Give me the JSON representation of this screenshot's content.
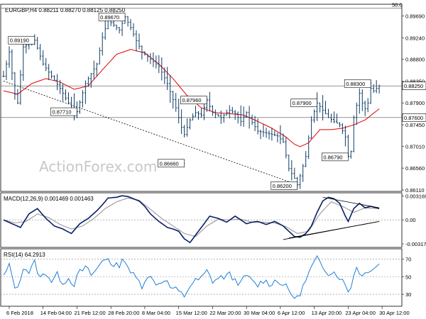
{
  "chart_data": {
    "type": "line",
    "title": "EURGBP,H4  0.88211 0.88270 0.88125 0.88250",
    "watermark": "ActionForex.com",
    "price_axis": {
      "ticks": [
        "0.89690",
        "0.89240",
        "0.88800",
        "0.88350",
        "0.87900",
        "0.87450",
        "0.87010",
        "0.86560",
        "0.86110"
      ],
      "tick_values": [
        0.8969,
        0.8924,
        0.888,
        0.8835,
        0.879,
        0.8745,
        0.8701,
        0.8656,
        0.8611
      ],
      "ylim": [
        0.8611,
        0.899
      ],
      "fib_label": "50.0",
      "fib_level": 0.8985,
      "current_price_label": "0.88250",
      "current_price": 0.8825,
      "support_label": "0.87600",
      "support_level": 0.876
    },
    "x_axis": {
      "labels": [
        "6 Feb 2018",
        "14 Feb 04:00",
        "21 Feb 12:00",
        "28 Feb 20:00",
        "8 Mar 04:00",
        "15 Mar 12:00",
        "22 Mar 20:00",
        "30 Mar 04:00",
        "6 Apr 12:00",
        "13 Apr 20:00",
        "23 Apr 04:00",
        "30 Apr 12:00"
      ],
      "label_bars": [
        2,
        14,
        26,
        38,
        50,
        62,
        74,
        86,
        98,
        110,
        122,
        134
      ]
    },
    "price_series": {
      "name": "EURGBP",
      "anchors": [
        [
          0,
          0.8845
        ],
        [
          2,
          0.8895
        ],
        [
          4,
          0.8808
        ],
        [
          5,
          0.879
        ],
        [
          7,
          0.8905
        ],
        [
          11,
          0.8919
        ],
        [
          14,
          0.887
        ],
        [
          17,
          0.8845
        ],
        [
          20,
          0.882
        ],
        [
          23,
          0.879
        ],
        [
          26,
          0.8772
        ],
        [
          29,
          0.883
        ],
        [
          33,
          0.887
        ],
        [
          35,
          0.8925
        ],
        [
          37,
          0.896
        ],
        [
          39,
          0.895
        ],
        [
          41,
          0.894
        ],
        [
          43,
          0.8967
        ],
        [
          45,
          0.8945
        ],
        [
          47,
          0.8918
        ],
        [
          49,
          0.8895
        ],
        [
          52,
          0.888
        ],
        [
          55,
          0.8865
        ],
        [
          58,
          0.883
        ],
        [
          61,
          0.878
        ],
        [
          63,
          0.874
        ],
        [
          64,
          0.8725
        ],
        [
          66,
          0.8755
        ],
        [
          68,
          0.877
        ],
        [
          70,
          0.8765
        ],
        [
          72,
          0.8796
        ],
        [
          74,
          0.877
        ],
        [
          77,
          0.876
        ],
        [
          80,
          0.8775
        ],
        [
          82,
          0.8768
        ],
        [
          84,
          0.8752
        ],
        [
          86,
          0.877
        ],
        [
          88,
          0.875
        ],
        [
          90,
          0.8732
        ],
        [
          93,
          0.8728
        ],
        [
          95,
          0.8725
        ],
        [
          97,
          0.8722
        ],
        [
          99,
          0.871
        ],
        [
          101,
          0.8655
        ],
        [
          103,
          0.8635
        ],
        [
          104,
          0.8622
        ],
        [
          105,
          0.864
        ],
        [
          107,
          0.868
        ],
        [
          109,
          0.8755
        ],
        [
          111,
          0.879
        ],
        [
          113,
          0.8775
        ],
        [
          115,
          0.876
        ],
        [
          117,
          0.8752
        ],
        [
          119,
          0.8745
        ],
        [
          121,
          0.872
        ],
        [
          122,
          0.868
        ],
        [
          123,
          0.869
        ],
        [
          124,
          0.876
        ],
        [
          126,
          0.881
        ],
        [
          127,
          0.879
        ],
        [
          128,
          0.8778
        ],
        [
          129,
          0.879
        ],
        [
          130,
          0.882
        ],
        [
          131,
          0.8815
        ],
        [
          133,
          0.8825
        ]
      ],
      "total_bars": 140
    },
    "moving_average": {
      "name": "MA",
      "color": "#e00000",
      "anchors": [
        [
          0,
          0.8815
        ],
        [
          5,
          0.8808
        ],
        [
          10,
          0.883
        ],
        [
          15,
          0.884
        ],
        [
          20,
          0.8833
        ],
        [
          25,
          0.8818
        ],
        [
          30,
          0.8825
        ],
        [
          35,
          0.8858
        ],
        [
          40,
          0.889
        ],
        [
          45,
          0.89
        ],
        [
          50,
          0.8893
        ],
        [
          55,
          0.887
        ],
        [
          60,
          0.884
        ],
        [
          65,
          0.8805
        ],
        [
          70,
          0.878
        ],
        [
          75,
          0.877
        ],
        [
          80,
          0.8768
        ],
        [
          85,
          0.8765
        ],
        [
          90,
          0.8752
        ],
        [
          95,
          0.8738
        ],
        [
          100,
          0.872
        ],
        [
          103,
          0.8705
        ],
        [
          105,
          0.87
        ],
        [
          108,
          0.8708
        ],
        [
          112,
          0.8735
        ],
        [
          116,
          0.8735
        ],
        [
          120,
          0.8738
        ],
        [
          124,
          0.8745
        ],
        [
          128,
          0.8755
        ],
        [
          133,
          0.8778
        ]
      ]
    },
    "trendline": {
      "from": [
        0,
        0.8835
      ],
      "to": [
        104,
        0.8622
      ]
    },
    "annotations": [
      {
        "text": "0.89670",
        "bar": 43,
        "price": 0.8967
      },
      {
        "text": "0.89190",
        "bar": 11,
        "price": 0.8919
      },
      {
        "text": "0.87710",
        "bar": 26,
        "price": 0.8772
      },
      {
        "text": "0.87960",
        "bar": 72,
        "price": 0.8796
      },
      {
        "text": "0.86660",
        "bar": 64,
        "price": 0.8666
      },
      {
        "text": "0.86200",
        "bar": 104,
        "price": 0.862
      },
      {
        "text": "0.87900",
        "bar": 111,
        "price": 0.879
      },
      {
        "text": "0.86790",
        "bar": 122,
        "price": 0.8679
      },
      {
        "text": "0.88300",
        "bar": 130,
        "price": 0.883
      }
    ],
    "macd": {
      "label": "MACD(12,26,9) 0.001469 0.001463",
      "ticks": [
        "0.003169",
        "0.00",
        "-0.003177"
      ],
      "tick_values": [
        0.003169,
        0.0,
        -0.003177
      ],
      "ylim": [
        -0.00345,
        0.0034
      ],
      "main_anchors": [
        [
          0,
          0.0
        ],
        [
          3,
          -0.0005
        ],
        [
          6,
          -0.001
        ],
        [
          9,
          0.0008
        ],
        [
          12,
          0.0015
        ],
        [
          15,
          0.0002
        ],
        [
          18,
          -0.0008
        ],
        [
          21,
          -0.0012
        ],
        [
          24,
          -0.0018
        ],
        [
          27,
          -0.0005
        ],
        [
          30,
          0.0002
        ],
        [
          33,
          0.0012
        ],
        [
          35,
          0.002
        ],
        [
          37,
          0.0029
        ],
        [
          40,
          0.003
        ],
        [
          42,
          0.0032
        ],
        [
          44,
          0.0031
        ],
        [
          46,
          0.0028
        ],
        [
          48,
          0.0025
        ],
        [
          50,
          0.0018
        ],
        [
          52,
          0.0008
        ],
        [
          55,
          -0.0002
        ],
        [
          58,
          -0.001
        ],
        [
          60,
          -0.0012
        ],
        [
          62,
          -0.0015
        ],
        [
          64,
          -0.0025
        ],
        [
          66,
          -0.003
        ],
        [
          68,
          -0.002
        ],
        [
          70,
          -0.001
        ],
        [
          73,
          0.0005
        ],
        [
          76,
          0.0002
        ],
        [
          79,
          -0.0003
        ],
        [
          82,
          0.0005
        ],
        [
          84,
          0.0
        ],
        [
          86,
          -0.0005
        ],
        [
          88,
          -0.0003
        ],
        [
          90,
          -0.0002
        ],
        [
          93,
          -0.0006
        ],
        [
          96,
          -0.0002
        ],
        [
          99,
          -0.0008
        ],
        [
          101,
          -0.0015
        ],
        [
          103,
          -0.0022
        ],
        [
          105,
          -0.0023
        ],
        [
          107,
          -0.0018
        ],
        [
          109,
          -0.0008
        ],
        [
          111,
          0.001
        ],
        [
          113,
          0.0025
        ],
        [
          115,
          0.003
        ],
        [
          117,
          0.0028
        ],
        [
          119,
          0.0022
        ],
        [
          121,
          0.0005
        ],
        [
          122,
          -0.0002
        ],
        [
          124,
          0.0015
        ],
        [
          126,
          0.0022
        ],
        [
          128,
          0.0016
        ],
        [
          130,
          0.0018
        ],
        [
          133,
          0.0015
        ]
      ],
      "signal_anchors": [
        [
          0,
          0.0
        ],
        [
          4,
          -0.0004
        ],
        [
          8,
          -0.0002
        ],
        [
          12,
          0.0008
        ],
        [
          16,
          0.0003
        ],
        [
          20,
          -0.0006
        ],
        [
          24,
          -0.0012
        ],
        [
          28,
          -0.0008
        ],
        [
          32,
          0.0002
        ],
        [
          36,
          0.0015
        ],
        [
          40,
          0.0024
        ],
        [
          44,
          0.0029
        ],
        [
          48,
          0.0026
        ],
        [
          52,
          0.0014
        ],
        [
          56,
          0.0002
        ],
        [
          60,
          -0.0008
        ],
        [
          64,
          -0.0018
        ],
        [
          68,
          -0.0022
        ],
        [
          72,
          -0.0008
        ],
        [
          76,
          0.0001
        ],
        [
          80,
          0.0
        ],
        [
          84,
          0.0001
        ],
        [
          88,
          -0.0003
        ],
        [
          92,
          -0.0003
        ],
        [
          96,
          -0.0004
        ],
        [
          100,
          -0.0009
        ],
        [
          104,
          -0.0018
        ],
        [
          108,
          -0.0015
        ],
        [
          112,
          0.0008
        ],
        [
          116,
          0.0024
        ],
        [
          120,
          0.0018
        ],
        [
          124,
          0.001
        ],
        [
          128,
          0.0016
        ],
        [
          133,
          0.0015
        ]
      ],
      "triangle_upper": {
        "from": [
          113,
          0.003
        ],
        "to": [
          133,
          0.0016
        ]
      },
      "triangle_lower": {
        "from": [
          101,
          -0.0024
        ],
        "to": [
          133,
          -0.0002
        ]
      },
      "lower_trendline": {
        "from": [
          99,
          -0.0026
        ],
        "to": [
          133,
          -0.0002
        ]
      }
    },
    "rsi": {
      "label": "RSI(14) 64.2913",
      "ticks": [
        "70",
        "50",
        "30"
      ],
      "tick_values": [
        70,
        50,
        30
      ],
      "ylim": [
        18,
        80
      ],
      "anchors": [
        [
          0,
          50
        ],
        [
          2,
          62
        ],
        [
          4,
          40
        ],
        [
          5,
          35
        ],
        [
          7,
          62
        ],
        [
          9,
          55
        ],
        [
          11,
          66
        ],
        [
          13,
          48
        ],
        [
          15,
          55
        ],
        [
          17,
          45
        ],
        [
          19,
          52
        ],
        [
          21,
          44
        ],
        [
          23,
          48
        ],
        [
          25,
          42
        ],
        [
          27,
          55
        ],
        [
          29,
          60
        ],
        [
          31,
          52
        ],
        [
          33,
          58
        ],
        [
          35,
          68
        ],
        [
          37,
          72
        ],
        [
          39,
          60
        ],
        [
          41,
          64
        ],
        [
          43,
          70
        ],
        [
          45,
          55
        ],
        [
          47,
          48
        ],
        [
          49,
          40
        ],
        [
          51,
          52
        ],
        [
          53,
          45
        ],
        [
          55,
          42
        ],
        [
          57,
          48
        ],
        [
          59,
          38
        ],
        [
          61,
          35
        ],
        [
          63,
          30
        ],
        [
          64,
          28
        ],
        [
          66,
          40
        ],
        [
          68,
          45
        ],
        [
          70,
          48
        ],
        [
          72,
          56
        ],
        [
          74,
          45
        ],
        [
          76,
          48
        ],
        [
          78,
          50
        ],
        [
          80,
          52
        ],
        [
          82,
          46
        ],
        [
          84,
          42
        ],
        [
          86,
          52
        ],
        [
          88,
          44
        ],
        [
          90,
          40
        ],
        [
          92,
          46
        ],
        [
          94,
          42
        ],
        [
          96,
          45
        ],
        [
          98,
          44
        ],
        [
          100,
          38
        ],
        [
          102,
          30
        ],
        [
          103,
          27
        ],
        [
          104,
          25
        ],
        [
          105,
          32
        ],
        [
          107,
          45
        ],
        [
          109,
          60
        ],
        [
          111,
          70
        ],
        [
          113,
          62
        ],
        [
          115,
          55
        ],
        [
          117,
          55
        ],
        [
          119,
          50
        ],
        [
          121,
          40
        ],
        [
          122,
          34
        ],
        [
          123,
          40
        ],
        [
          125,
          62
        ],
        [
          127,
          50
        ],
        [
          129,
          58
        ],
        [
          131,
          60
        ],
        [
          133,
          64
        ]
      ]
    }
  }
}
